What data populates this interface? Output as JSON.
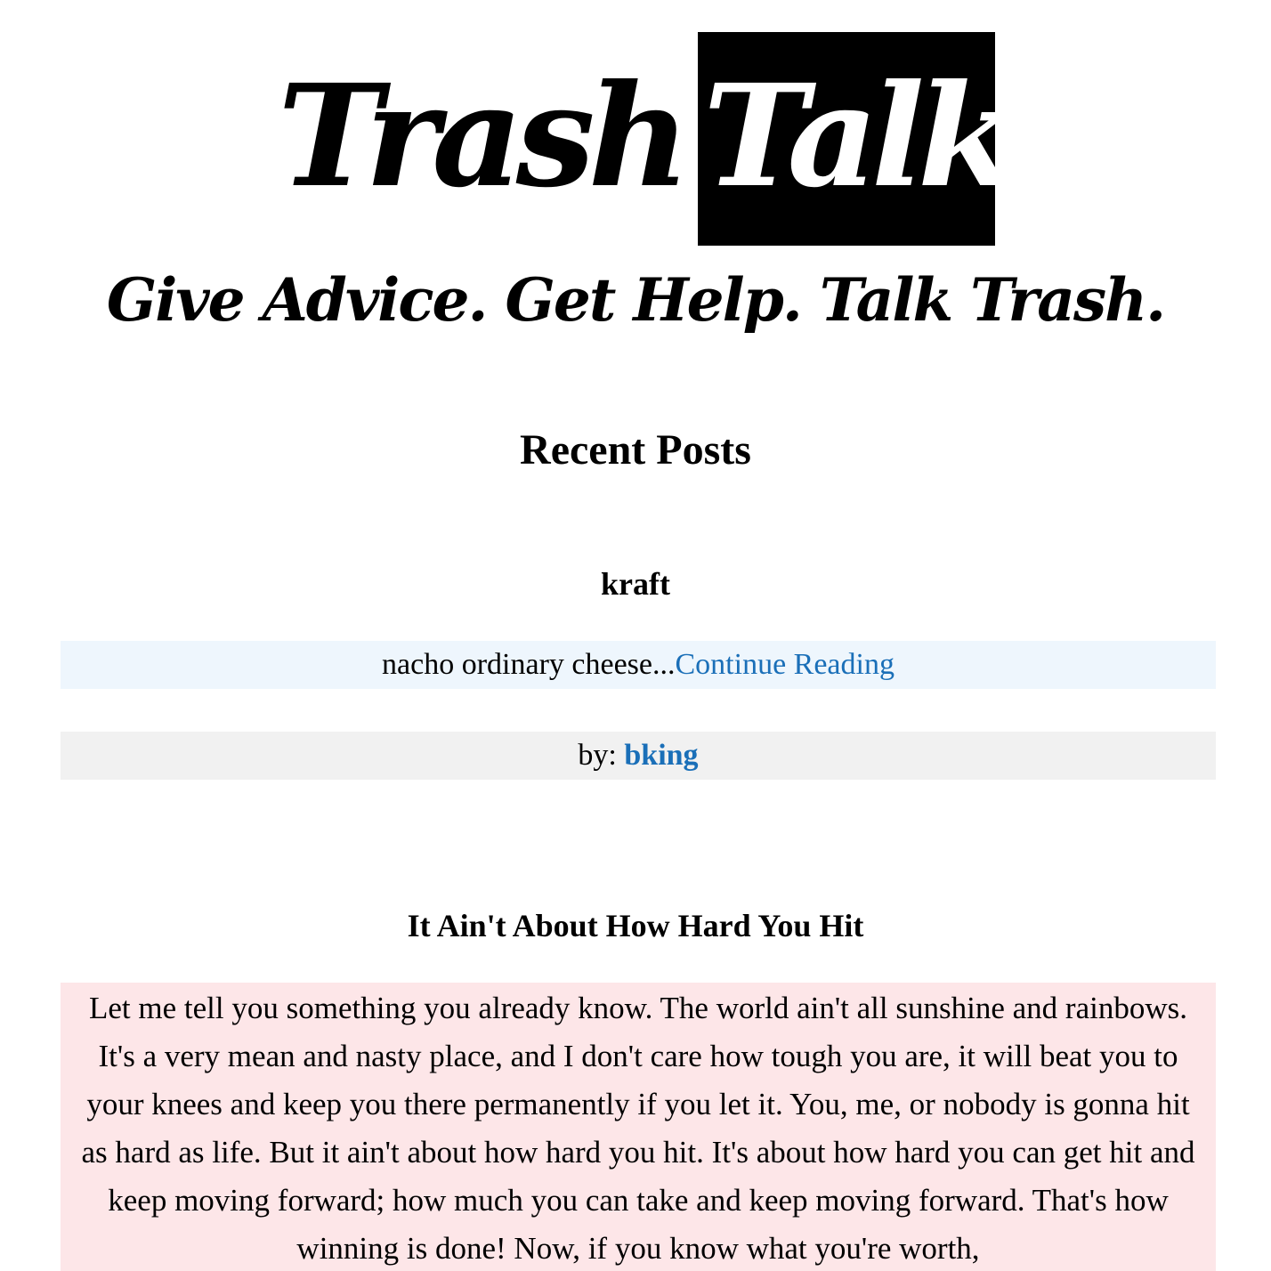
{
  "header": {
    "logo_word1": "Trash",
    "logo_word2": "Talk",
    "tagline": "Give Advice. Get Help. Talk Trash."
  },
  "recent": {
    "title": "Recent Posts"
  },
  "posts": [
    {
      "title": "kraft",
      "excerpt": "nacho ordinary cheese...",
      "continue_label": "Continue Reading",
      "by_label": "by:",
      "author": "bking"
    },
    {
      "title": "It Ain't About How Hard You Hit",
      "excerpt": "Let me tell you something you already know. The world ain't all sunshine and rainbows. It's a very mean and nasty place, and I don't care how tough you are, it will beat you to your knees and keep you there permanently if you let it. You, me, or nobody is gonna hit as hard as life. But it ain't about how hard you hit. It's about how hard you can get hit and keep moving forward; how much you can take and keep moving forward. That's how winning is done! Now, if you know what you're worth,"
    }
  ],
  "colors": {
    "link": "#1a6fb8",
    "excerpt_bg_blue": "#eef6fd",
    "byline_bg": "#f1f1f1",
    "excerpt_bg_pink": "#fde6e8"
  }
}
